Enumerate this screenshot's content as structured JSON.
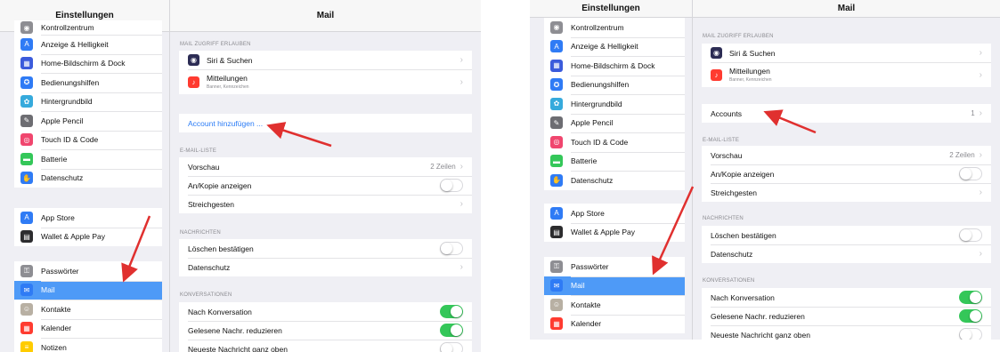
{
  "colors": {
    "accent": "#2b7cf6",
    "selected": "#4e9af7",
    "toggle_on": "#34c759",
    "annotation_arrow": "#e0302f"
  },
  "left": {
    "sidebar": {
      "title": "Einstellungen",
      "items": [
        {
          "label": "Kontrollzentrum",
          "icon": "control-center-icon",
          "color": "#8e8e93"
        },
        {
          "label": "Anzeige & Helligkeit",
          "icon": "display-icon",
          "color": "#2f7bf5"
        },
        {
          "label": "Home-Bildschirm & Dock",
          "icon": "home-grid-icon",
          "color": "#3b5bdb"
        },
        {
          "label": "Bedienungshilfen",
          "icon": "accessibility-icon",
          "color": "#2f7bf5"
        },
        {
          "label": "Hintergrundbild",
          "icon": "wallpaper-icon",
          "color": "#36aadc"
        },
        {
          "label": "Apple Pencil",
          "icon": "pencil-icon",
          "color": "#6d6d72"
        },
        {
          "label": "Touch ID & Code",
          "icon": "fingerprint-icon",
          "color": "#f0466e"
        },
        {
          "label": "Batterie",
          "icon": "battery-icon",
          "color": "#34c759"
        },
        {
          "label": "Datenschutz",
          "icon": "hand-icon",
          "color": "#2f7bf5"
        },
        {
          "label": "App Store",
          "icon": "app-store-icon",
          "color": "#2f7bf5"
        },
        {
          "label": "Wallet & Apple Pay",
          "icon": "wallet-icon",
          "color": "#2c2c2e"
        },
        {
          "label": "Passwörter",
          "icon": "key-icon",
          "color": "#8e8e93"
        },
        {
          "label": "Mail",
          "icon": "mail-icon",
          "color": "#2f7bf5"
        },
        {
          "label": "Kontakte",
          "icon": "contacts-icon",
          "color": "#b8b0a3"
        },
        {
          "label": "Kalender",
          "icon": "calendar-icon",
          "color": "#ff3b30"
        },
        {
          "label": "Notizen",
          "icon": "notes-icon",
          "color": "#ffcc00"
        }
      ]
    },
    "main": {
      "title": "Mail",
      "allow_access_header": "MAIL ZUGRIFF ERLAUBEN",
      "siri": "Siri & Suchen",
      "notifications": "Mitteilungen",
      "notifications_sub": "Banner, Kennzeichen",
      "add_account": "Account hinzufügen ...",
      "list_header": "E-MAIL-LISTE",
      "preview": "Vorschau",
      "preview_value": "2 Zeilen",
      "show_to_cc": "An/Kopie anzeigen",
      "swipe": "Streichgesten",
      "messages_header": "NACHRICHTEN",
      "confirm_delete": "Löschen bestätigen",
      "privacy": "Datenschutz",
      "threads_header": "KONVERSATIONEN",
      "by_thread": "Nach Konversation",
      "collapse_read": "Gelesene Nachr. reduzieren",
      "newest_on_top": "Neueste Nachricht ganz oben"
    }
  },
  "right": {
    "sidebar": {
      "title": "Einstellungen",
      "items": [
        {
          "label": "Kontrollzentrum",
          "icon": "control-center-icon",
          "color": "#8e8e93"
        },
        {
          "label": "Anzeige & Helligkeit",
          "icon": "display-icon",
          "color": "#2f7bf5"
        },
        {
          "label": "Home-Bildschirm & Dock",
          "icon": "home-grid-icon",
          "color": "#3b5bdb"
        },
        {
          "label": "Bedienungshilfen",
          "icon": "accessibility-icon",
          "color": "#2f7bf5"
        },
        {
          "label": "Hintergrundbild",
          "icon": "wallpaper-icon",
          "color": "#36aadc"
        },
        {
          "label": "Apple Pencil",
          "icon": "pencil-icon",
          "color": "#6d6d72"
        },
        {
          "label": "Touch ID & Code",
          "icon": "fingerprint-icon",
          "color": "#f0466e"
        },
        {
          "label": "Batterie",
          "icon": "battery-icon",
          "color": "#34c759"
        },
        {
          "label": "Datenschutz",
          "icon": "hand-icon",
          "color": "#2f7bf5"
        },
        {
          "label": "App Store",
          "icon": "app-store-icon",
          "color": "#2f7bf5"
        },
        {
          "label": "Wallet & Apple Pay",
          "icon": "wallet-icon",
          "color": "#2c2c2e"
        },
        {
          "label": "Passwörter",
          "icon": "key-icon",
          "color": "#8e8e93"
        },
        {
          "label": "Mail",
          "icon": "mail-icon",
          "color": "#2f7bf5"
        },
        {
          "label": "Kontakte",
          "icon": "contacts-icon",
          "color": "#b8b0a3"
        },
        {
          "label": "Kalender",
          "icon": "calendar-icon",
          "color": "#ff3b30"
        }
      ]
    },
    "main": {
      "title": "Mail",
      "allow_access_header": "MAIL ZUGRIFF ERLAUBEN",
      "siri": "Siri & Suchen",
      "notifications": "Mitteilungen",
      "notifications_sub": "Banner, Kennzeichen",
      "accounts": "Accounts",
      "accounts_value": "1",
      "list_header": "E-MAIL-LISTE",
      "preview": "Vorschau",
      "preview_value": "2 Zeilen",
      "show_to_cc": "An/Kopie anzeigen",
      "swipe": "Streichgesten",
      "messages_header": "NACHRICHTEN",
      "confirm_delete": "Löschen bestätigen",
      "privacy": "Datenschutz",
      "threads_header": "KONVERSATIONEN",
      "by_thread": "Nach Konversation",
      "collapse_read": "Gelesene Nachr. reduzieren",
      "newest_on_top": "Neueste Nachricht ganz oben"
    }
  }
}
